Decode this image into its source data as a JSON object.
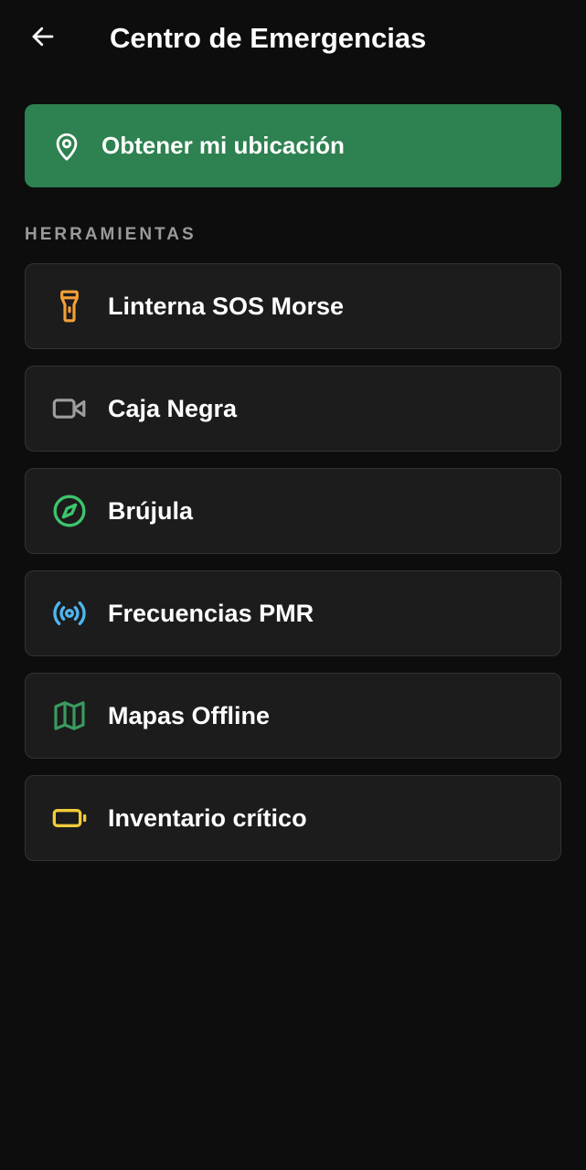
{
  "header": {
    "title": "Centro de Emergencias",
    "back_icon": "arrow-left-icon"
  },
  "location_button": {
    "label": "Obtener mi ubicación",
    "icon": "map-pin-icon",
    "color": "#2e8150"
  },
  "section": {
    "title": "HERRAMIENTAS"
  },
  "tools": [
    {
      "label": "Linterna SOS Morse",
      "icon": "flashlight-icon",
      "color": "#f5a037"
    },
    {
      "label": "Caja Negra",
      "icon": "video-camera-icon",
      "color": "#9e9e9e"
    },
    {
      "label": "Brújula",
      "icon": "compass-icon",
      "color": "#3ec46d"
    },
    {
      "label": "Frecuencias PMR",
      "icon": "radio-broadcast-icon",
      "color": "#4fb6ef"
    },
    {
      "label": "Mapas Offline",
      "icon": "map-icon",
      "color": "#3b9a5f"
    },
    {
      "label": "Inventario crítico",
      "icon": "battery-icon",
      "color": "#f2cb3a"
    }
  ]
}
